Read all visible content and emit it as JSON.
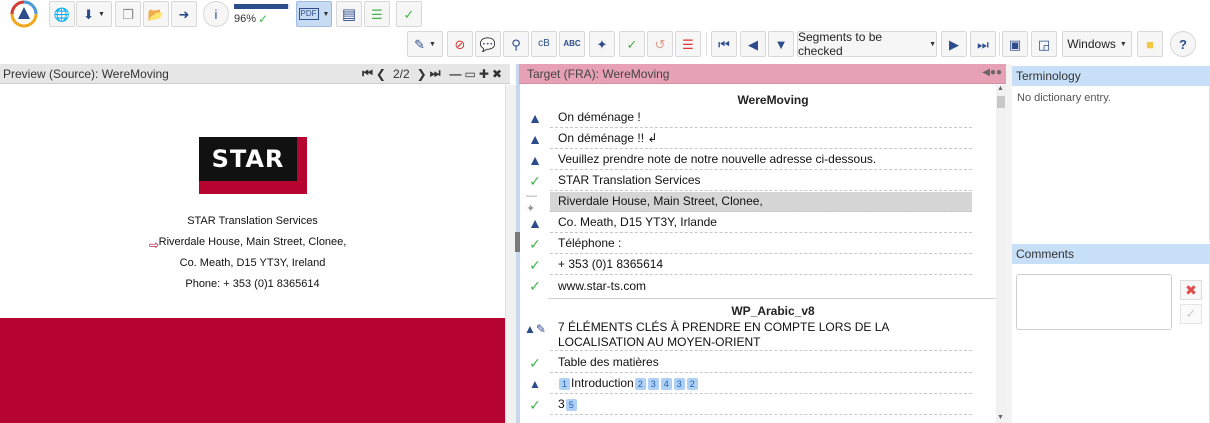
{
  "toolbar": {
    "progress_percent": 96,
    "progress_label": "96%",
    "filter_label": "Segments to be checked",
    "windows_label": "Windows",
    "pdf_label": "PDF"
  },
  "preview": {
    "title": "Preview (Source): WereMoving",
    "page_label": "2/2",
    "logo_text": "STAR",
    "lines": [
      "STAR Translation Services",
      "Riverdale House, Main Street, Clonee,",
      "Co. Meath, D15 YT3Y, Ireland",
      "Phone: + 353 (0)1 8365614"
    ]
  },
  "target": {
    "title": "Target (FRA): WereMoving",
    "doc1_header": "WereMoving",
    "doc2_header": "WP_Arabic_v8",
    "segments": [
      {
        "text": "On déménage !"
      },
      {
        "text": "On déménage !! ↲"
      },
      {
        "text": "Veuillez prendre note de notre nouvelle adresse ci-dessous."
      },
      {
        "text": "STAR Translation Services"
      },
      {
        "text": "Riverdale House, Main Street, Clonee,"
      },
      {
        "text": "Co. Meath, D15 YT3Y, Irlande"
      },
      {
        "text": "Téléphone :"
      },
      {
        "text": "+ 353 (0)1 8365614"
      },
      {
        "text": "www.star-ts.com"
      }
    ],
    "segments2": [
      {
        "text": "7 ÉLÉMENTS CLÉS À PRENDRE EN COMPTE LORS DE LA LOCALISATION AU MOYEN-ORIENT"
      },
      {
        "text": "Table des matières"
      },
      {
        "text": "Introduction",
        "tags": [
          "1",
          "2",
          "3",
          "4",
          "3",
          "2"
        ]
      },
      {
        "text": "3",
        "tags": [
          "5"
        ]
      }
    ]
  },
  "terminology": {
    "title": "Terminology",
    "empty_text": "No dictionary entry."
  },
  "comments": {
    "title": "Comments"
  },
  "colors": {
    "accent": "#2c4c8c",
    "brand_red": "#b5042f",
    "panel_blue": "#c7e0f8",
    "target_header": "#e7a1b4",
    "check_green": "#43b24a"
  }
}
